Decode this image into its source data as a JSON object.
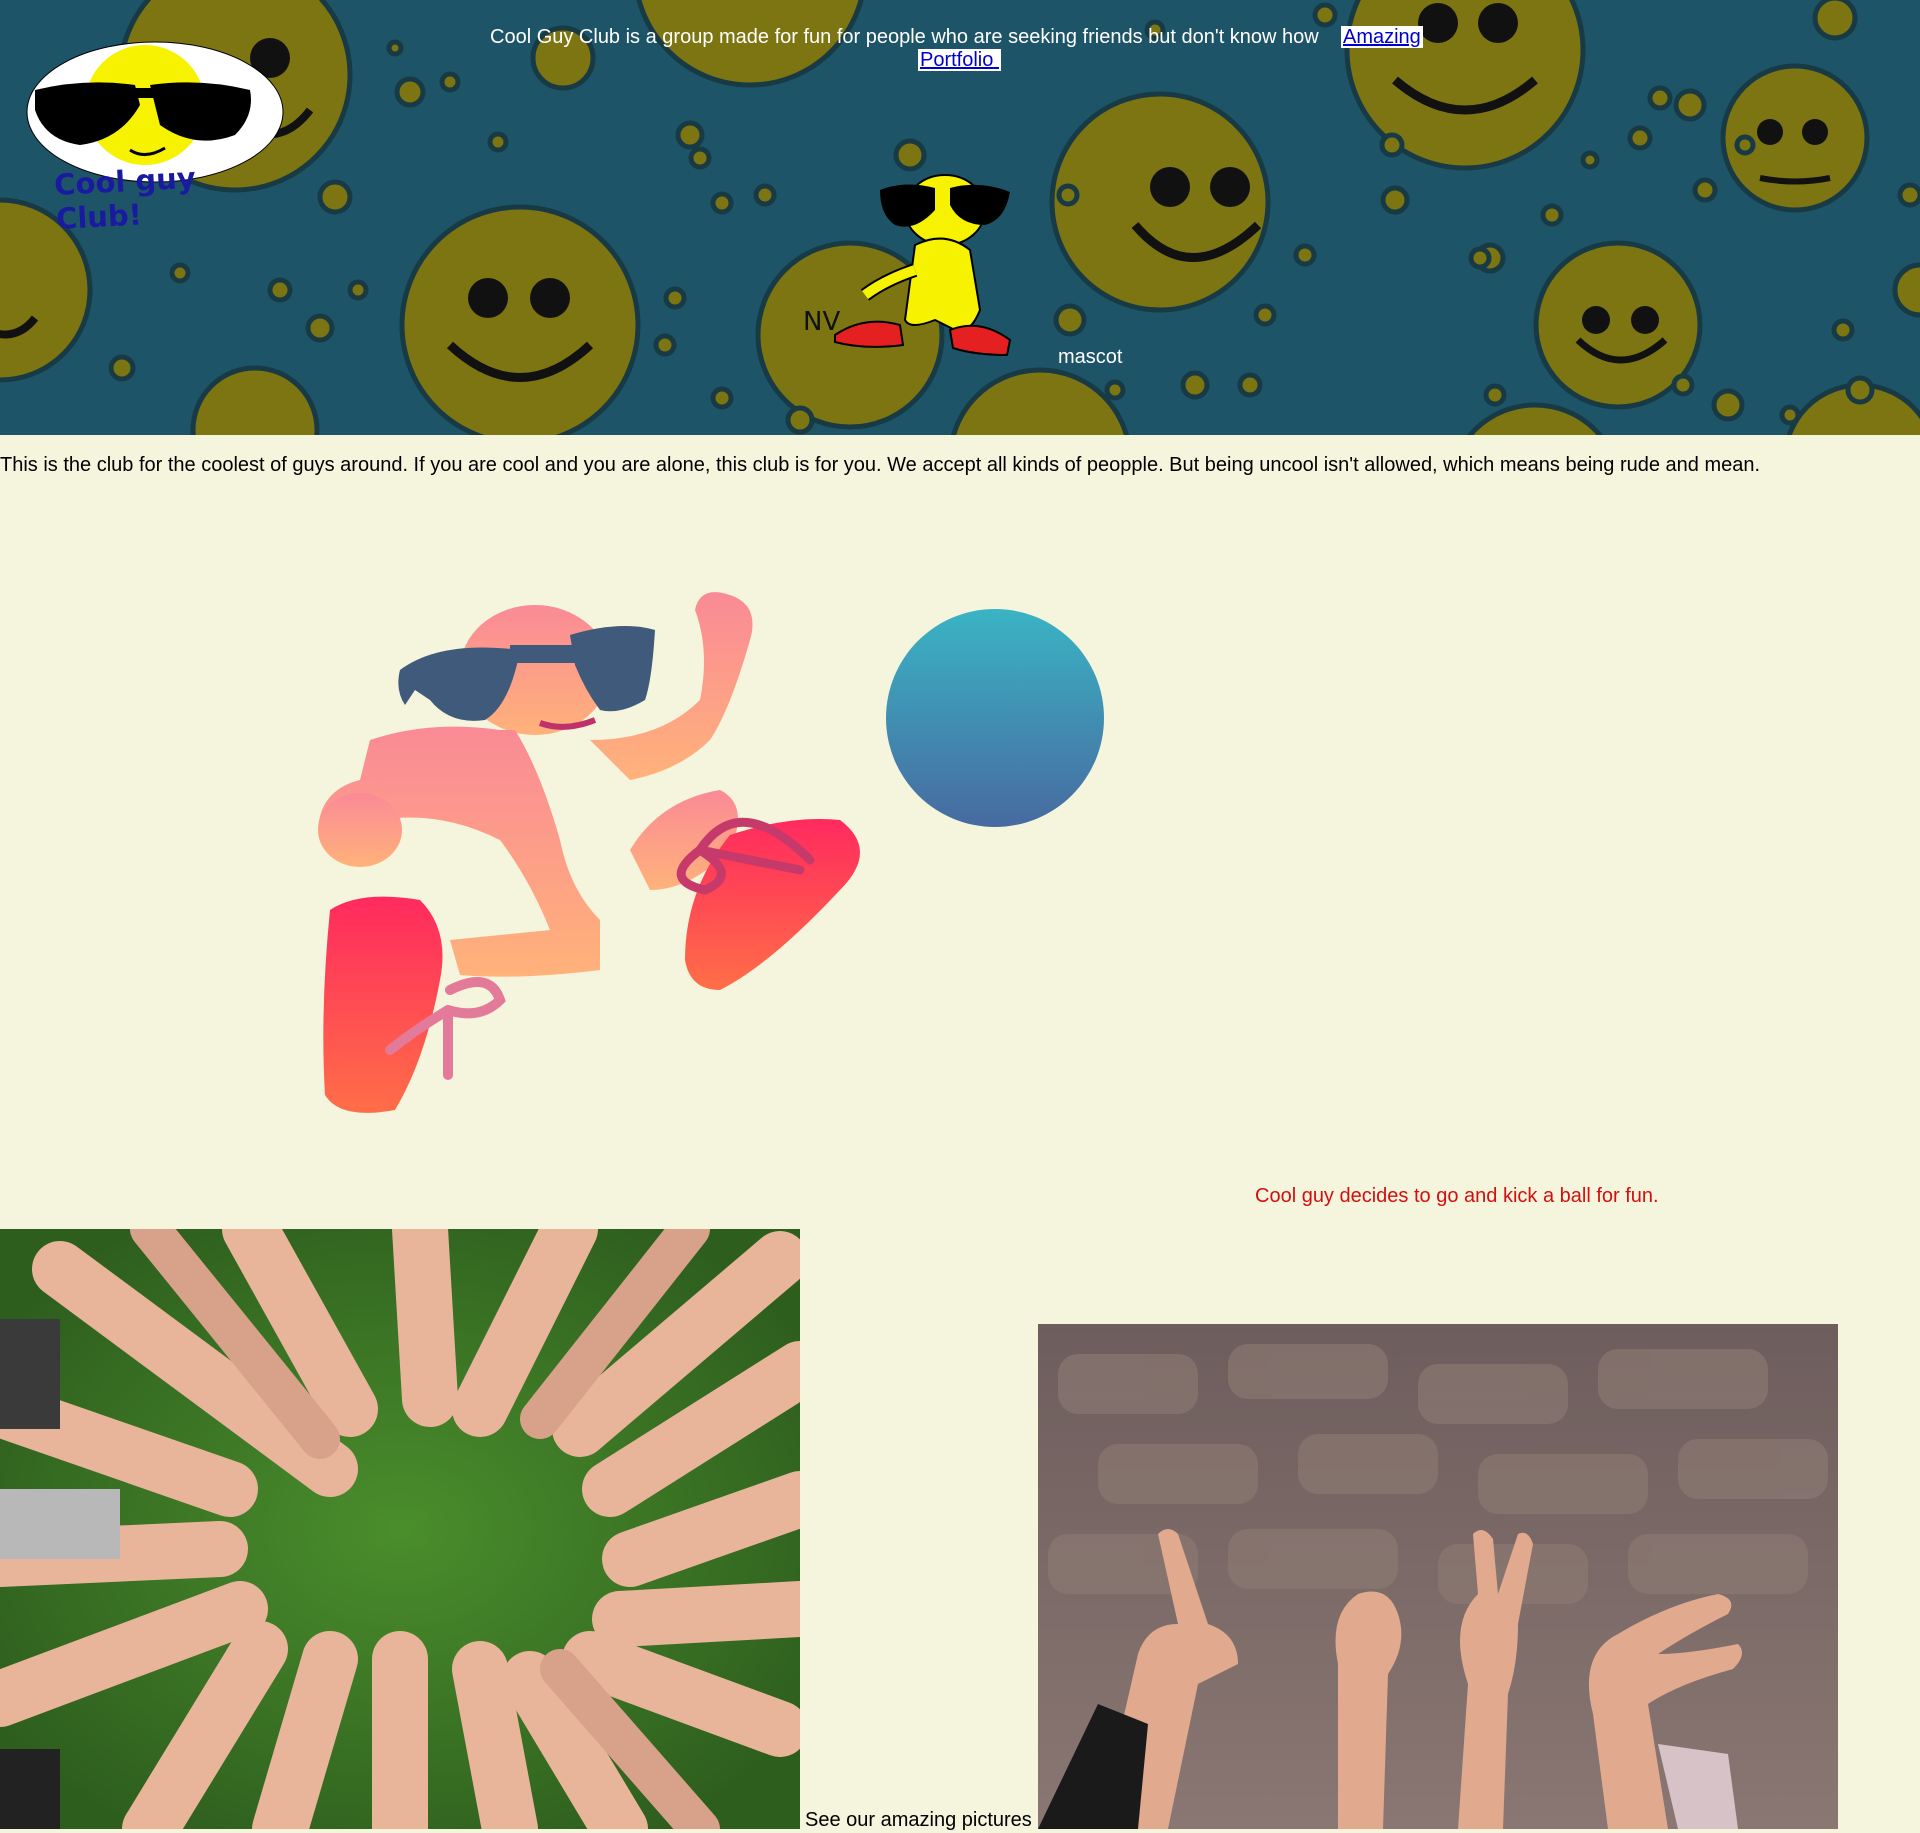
{
  "header": {
    "tagline": "Cool Guy Club is a group made for fun for people who are seeking friends but don't know how",
    "link_line1": "Amazing",
    "link_line2": "Portfolio",
    "mascot_label": "mascot",
    "logo_text": "Cool guy Club!"
  },
  "main": {
    "intro": "This is the club for the coolest of guys around. If you are cool and you are alone, this club is for you. We accept all kinds of peopple. But being uncool isn't allowed, which means being rude and mean.",
    "illustration_caption": "Cool guy decides to go and kick a ball for fun.",
    "pictures_caption": "See our amazing pictures"
  },
  "colors": {
    "page_bg": "#f5f4dc",
    "header_bg": "#1e5468",
    "smiley": "#7d7512",
    "caption_red": "#d21010",
    "link": "#0000cc"
  },
  "icons": [
    "cool-guy-logo",
    "mascot-figure",
    "kicking-cool-guy",
    "ball",
    "hands-in-circle-photo",
    "love-hands-photo"
  ]
}
